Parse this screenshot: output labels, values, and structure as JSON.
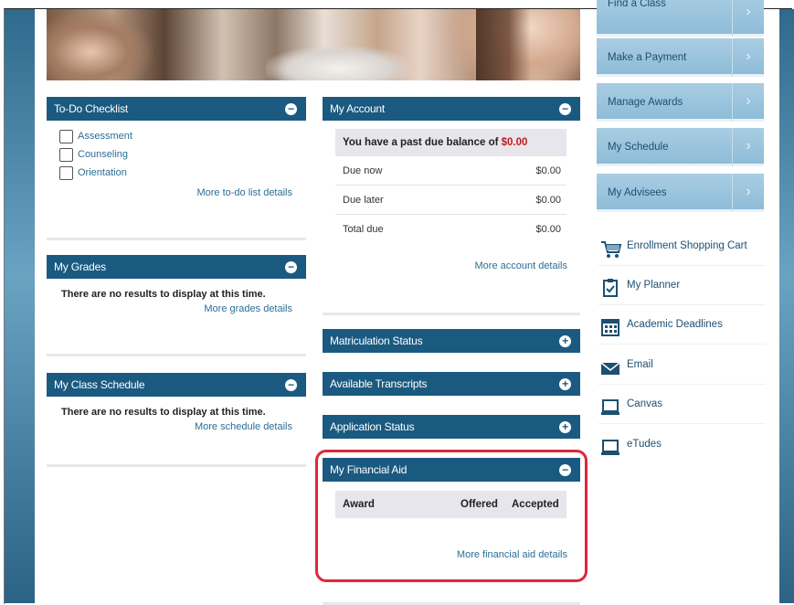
{
  "todo": {
    "title": "To-Do Checklist",
    "items": [
      "Assessment",
      "Counseling",
      "Orientation"
    ],
    "more_link": "More to-do list details"
  },
  "grades": {
    "title": "My Grades",
    "empty": "There are no results to display at this time.",
    "more_link": "More grades details"
  },
  "class_schedule": {
    "title": "My Class Schedule",
    "empty": "There are no results to display at this time.",
    "more_link": "More schedule details"
  },
  "account": {
    "title": "My Account",
    "banner_text": "You have a past due balance of ",
    "banner_amount": "$0.00",
    "rows": [
      {
        "label": "Due now",
        "value": "$0.00"
      },
      {
        "label": "Due later",
        "value": "$0.00"
      },
      {
        "label": "Total due",
        "value": "$0.00"
      }
    ],
    "more_link": "More account details"
  },
  "collapsed_panels": [
    "Matriculation Status",
    "Available Transcripts",
    "Application Status"
  ],
  "financial_aid": {
    "title": "My Financial Aid",
    "columns": [
      "Award",
      "Offered",
      "Accepted"
    ],
    "more_link": "More financial aid details"
  },
  "sidebar": {
    "buttons": [
      "Find a Class",
      "Make a Payment",
      "Manage Awards",
      "My Schedule",
      "My Advisees"
    ],
    "links": [
      {
        "label": "Enrollment Shopping Cart",
        "icon": "shopping-cart-icon"
      },
      {
        "label": "My Planner",
        "icon": "planner-icon"
      },
      {
        "label": "Academic Deadlines",
        "icon": "calendar-icon"
      },
      {
        "label": "Email",
        "icon": "email-icon"
      },
      {
        "label": "Canvas",
        "icon": "canvas-icon"
      },
      {
        "label": "eTudes",
        "icon": "etudes-icon"
      }
    ]
  },
  "colors": {
    "header_blue": "#1b5a80",
    "side_button": "#9cc6df",
    "past_due_red": "#c21b1b",
    "highlight_red": "#e0263b"
  }
}
